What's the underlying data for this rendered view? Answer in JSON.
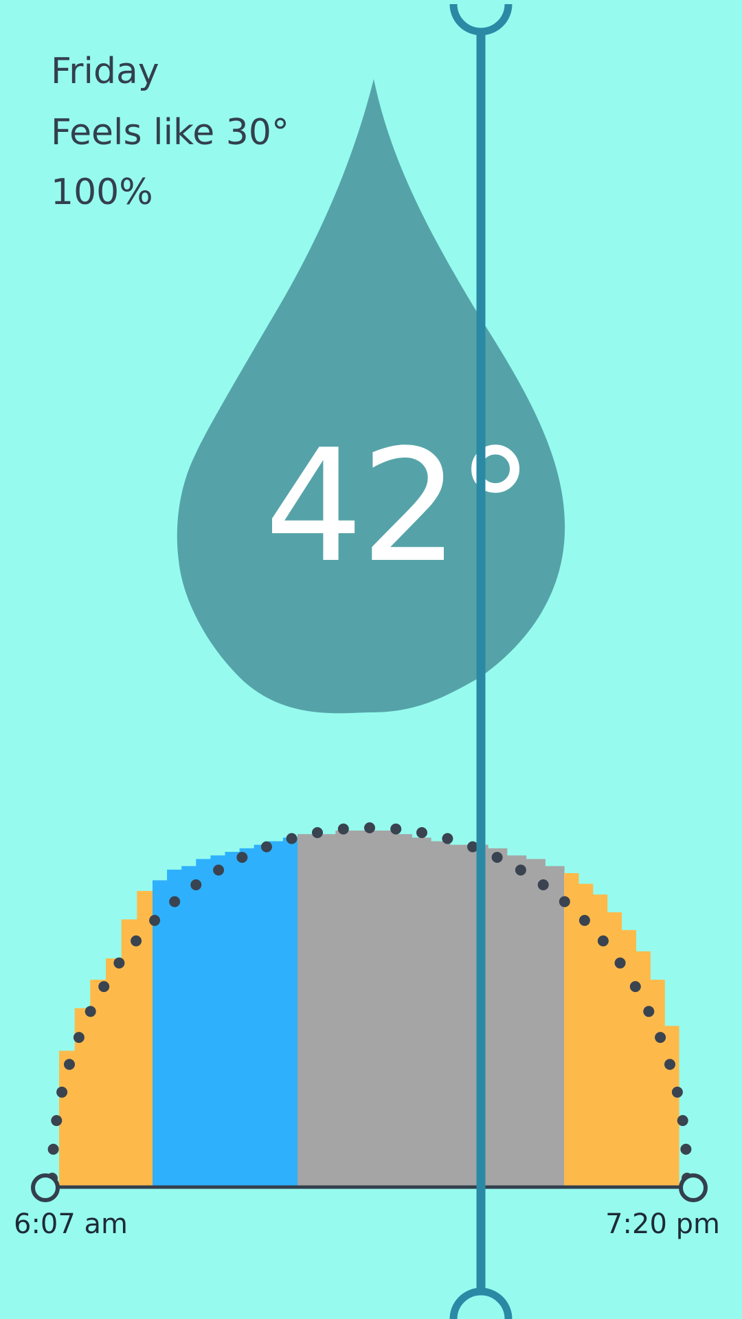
{
  "weather": {
    "day": "Friday",
    "feels_like": "Feels like 30°",
    "humidity": "100%",
    "temperature": "42°"
  },
  "sun": {
    "sunrise": "6:07 am",
    "sunset": "7:20 pm"
  },
  "chart_data": {
    "type": "bar",
    "categories": [
      "6:07 am",
      "7:20 pm"
    ],
    "segments": [
      {
        "color": "#fdba4b",
        "bars": 6,
        "values": [
          0.38,
          0.5,
          0.58,
          0.64,
          0.75,
          0.83
        ]
      },
      {
        "color": "#2eb0fd",
        "bars": 10,
        "values": [
          0.86,
          0.89,
          0.9,
          0.92,
          0.93,
          0.94,
          0.95,
          0.96,
          0.97,
          0.98
        ]
      },
      {
        "color": "#a5a5a5",
        "bars": 14,
        "values": [
          0.99,
          0.99,
          1.0,
          1.0,
          1.0,
          0.99,
          0.98,
          0.97,
          0.96,
          0.96,
          0.95,
          0.93,
          0.92,
          0.9
        ]
      },
      {
        "color": "#fdba4b",
        "bars": 8,
        "values": [
          0.88,
          0.85,
          0.82,
          0.77,
          0.72,
          0.66,
          0.58,
          0.45
        ]
      }
    ],
    "colors": {
      "orange": "#fdba4b",
      "blue": "#2eb0fd",
      "gray": "#a5a5a5",
      "dots": "#3a4350",
      "baseline": "#333f4d"
    }
  },
  "colors": {
    "background": "#96fbee",
    "drop": "#55a3a8",
    "slider": "#2a8aa5",
    "text": "#333f4d"
  }
}
